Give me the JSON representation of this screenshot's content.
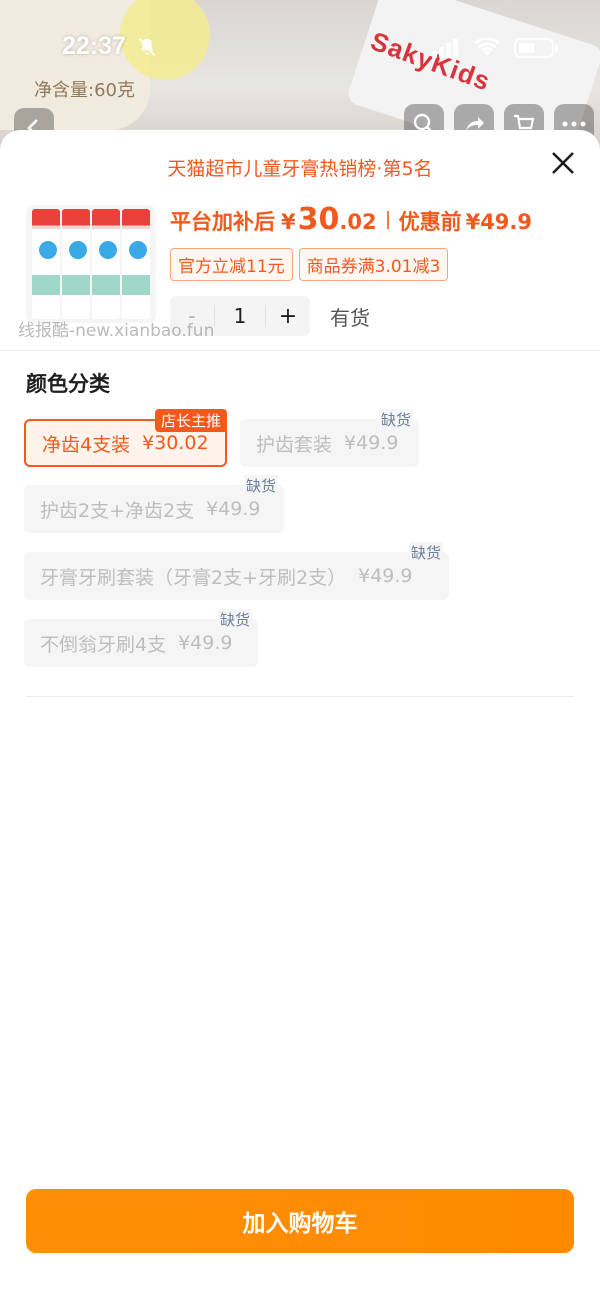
{
  "status_bar": {
    "time": "22:37"
  },
  "background": {
    "brand_text": "SakyKids",
    "package_text": "净含量:60克"
  },
  "sheet": {
    "rank_title": "天猫超市儿童牙膏热销榜·第5名",
    "price": {
      "label": "平台加补后",
      "currency": "¥",
      "integer": "30",
      "decimal": ".02",
      "before_label": "优惠前",
      "before_value": "¥49.9"
    },
    "coupons": [
      "官方立减11元",
      "商品券满3.01减3"
    ],
    "quantity": {
      "minus": "-",
      "value": "1",
      "plus": "+",
      "stock": "有货"
    },
    "watermark": "线报酷-new.xianbao.fun",
    "section_title": "颜色分类",
    "options": [
      {
        "name": "净齿4支装",
        "price": "¥30.02",
        "badge": "店长主推",
        "selected": true
      },
      {
        "name": "护齿套装",
        "price": "¥49.9",
        "badge": "缺货",
        "selected": false
      },
      {
        "name": "护齿2支+净齿2支",
        "price": "¥49.9",
        "badge": "缺货",
        "selected": false
      },
      {
        "name": "牙膏牙刷套装（牙膏2支+牙刷2支）",
        "price": "¥49.9",
        "badge": "缺货",
        "selected": false
      },
      {
        "name": "不倒翁牙刷4支",
        "price": "¥49.9",
        "badge": "缺货",
        "selected": false
      }
    ],
    "add_to_cart": "加入购物车"
  },
  "colors": {
    "accent": "#f2591d",
    "cart_button": "#ff8c02",
    "oos_badge": "#6d7f9e"
  }
}
